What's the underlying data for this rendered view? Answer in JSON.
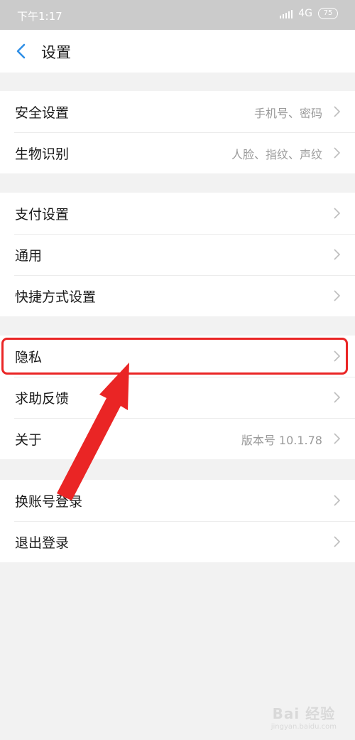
{
  "status_bar": {
    "time": "下午1:17",
    "network": "4G",
    "battery": "75"
  },
  "header": {
    "title": "设置"
  },
  "groups": [
    {
      "items": [
        {
          "label": "安全设置",
          "value": "手机号、密码"
        },
        {
          "label": "生物识别",
          "value": "人脸、指纹、声纹"
        }
      ]
    },
    {
      "items": [
        {
          "label": "支付设置",
          "value": ""
        },
        {
          "label": "通用",
          "value": ""
        },
        {
          "label": "快捷方式设置",
          "value": ""
        }
      ]
    },
    {
      "items": [
        {
          "label": "隐私",
          "value": ""
        },
        {
          "label": "求助反馈",
          "value": ""
        },
        {
          "label": "关于",
          "value": "版本号 10.1.78"
        }
      ]
    },
    {
      "items": [
        {
          "label": "换账号登录",
          "value": ""
        },
        {
          "label": "退出登录",
          "value": ""
        }
      ]
    }
  ],
  "annotation": {
    "color": "#ea2525"
  },
  "watermark": {
    "main": "Bai 经验",
    "sub": "jingyan.baidu.com"
  }
}
